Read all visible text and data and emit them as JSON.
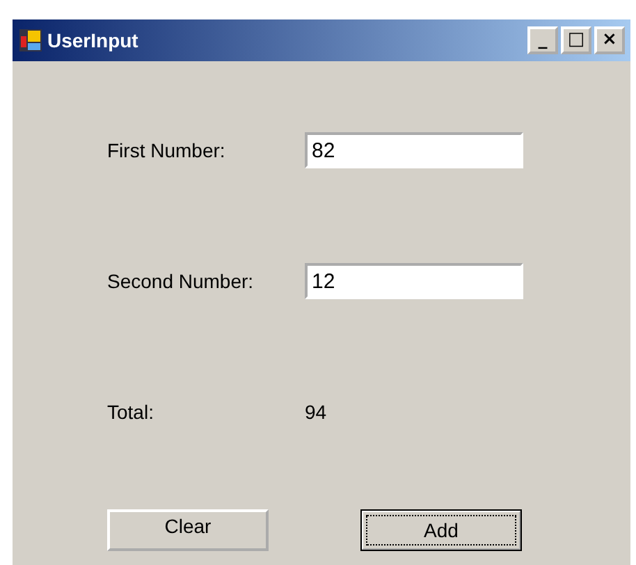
{
  "window": {
    "title": "UserInput",
    "controls": [
      "_",
      "□",
      "×"
    ]
  },
  "fields": [
    {
      "label": "First Number:",
      "value": "82"
    },
    {
      "label": "Second Number:",
      "value": "12"
    }
  ],
  "total": {
    "label": "Total:",
    "value": "94"
  },
  "buttons": [
    {
      "label": "Clear",
      "focused": false
    },
    {
      "label": "Add",
      "focused": true
    }
  ]
}
